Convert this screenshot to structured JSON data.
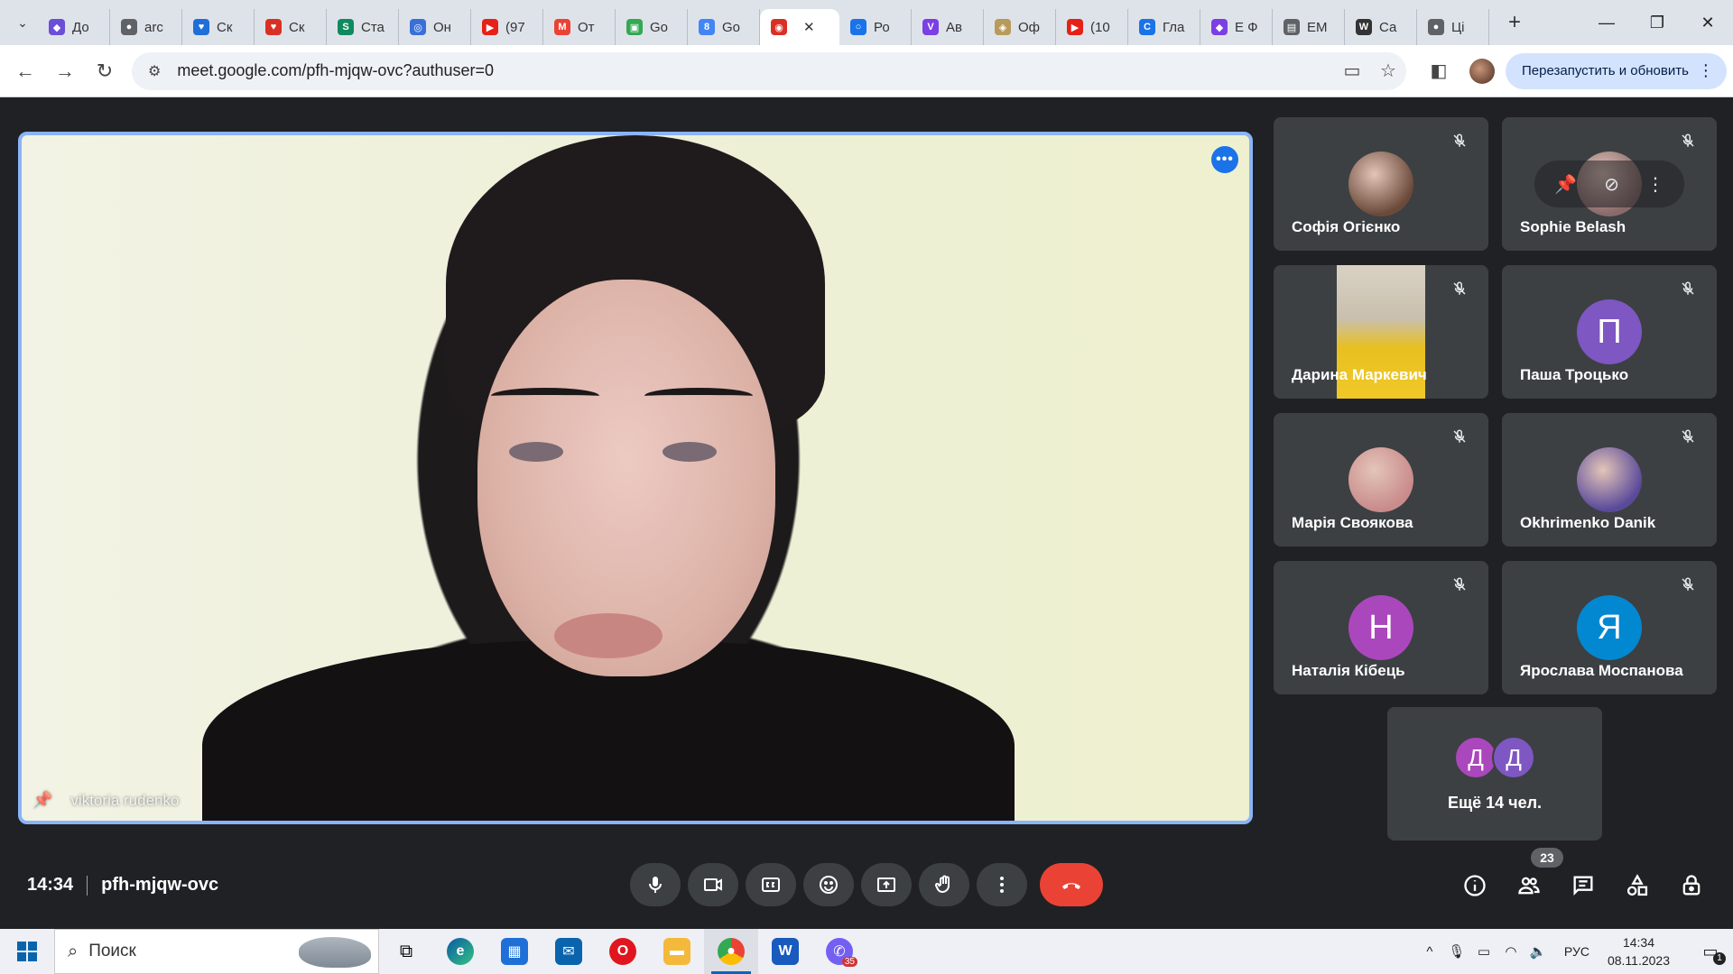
{
  "browser": {
    "tabs": [
      {
        "label": "До",
        "color": "#6b4fd8",
        "glyph": "◆"
      },
      {
        "label": "arc",
        "color": "#5f6368",
        "glyph": "●"
      },
      {
        "label": "Ск",
        "color": "#1e6fd9",
        "glyph": "♥"
      },
      {
        "label": "Ск",
        "color": "#d93025",
        "glyph": "♥"
      },
      {
        "label": "Ста",
        "color": "#0f8a5f",
        "glyph": "S"
      },
      {
        "label": "Он",
        "color": "#3a6fd8",
        "glyph": "◎"
      },
      {
        "label": "(97",
        "color": "#e62117",
        "glyph": "▶"
      },
      {
        "label": "От",
        "color": "#ea4335",
        "glyph": "M"
      },
      {
        "label": "Go",
        "color": "#34a853",
        "glyph": "▣"
      },
      {
        "label": "Go",
        "color": "#4285f4",
        "glyph": "8"
      },
      {
        "label": "",
        "color": "#d93025",
        "glyph": "◉",
        "active": true
      },
      {
        "label": "Ро",
        "color": "#1a73e8",
        "glyph": "○"
      },
      {
        "label": "Ав",
        "color": "#7b3fe4",
        "glyph": "V"
      },
      {
        "label": "Оф",
        "color": "#b89a5a",
        "glyph": "◈"
      },
      {
        "label": "(10",
        "color": "#e62117",
        "glyph": "▶"
      },
      {
        "label": "Гла",
        "color": "#1a73e8",
        "glyph": "C"
      },
      {
        "label": "Е Ф",
        "color": "#7b3fe4",
        "glyph": "◆"
      },
      {
        "label": "ЕМ",
        "color": "#5f6368",
        "glyph": "▤"
      },
      {
        "label": "Са",
        "color": "#333333",
        "glyph": "W"
      },
      {
        "label": "Ці",
        "color": "#5f6368",
        "glyph": "●"
      }
    ],
    "url": "meet.google.com/pfh-mjqw-ovc?authuser=0",
    "relaunch_label": "Перезапустить и обновить"
  },
  "meeting": {
    "main_speaker": "viktoria rudenko",
    "time": "14:34",
    "code": "pfh-mjqw-ovc",
    "participant_count": "23",
    "participants": [
      {
        "name": "Софія Огієнко",
        "type": "photo",
        "color": "#6b4a3a",
        "initial": ""
      },
      {
        "name": "Sophie Belash",
        "type": "photo",
        "color": "#8a6a6a",
        "initial": ""
      },
      {
        "name": "Дарина Маркевич",
        "type": "video",
        "color": "#e8c020",
        "initial": ""
      },
      {
        "name": "Паша Троцько",
        "type": "initial",
        "color": "#7e57c2",
        "initial": "П"
      },
      {
        "name": "Марія Своякова",
        "type": "photo",
        "color": "#c98b8b",
        "initial": ""
      },
      {
        "name": "Okhrimenko Danik",
        "type": "photo",
        "color": "#5a4a9a",
        "initial": ""
      },
      {
        "name": "Наталія Кібець",
        "type": "initial",
        "color": "#ab47bc",
        "initial": "Н"
      },
      {
        "name": "Ярослава Моспанова",
        "type": "initial",
        "color": "#0288d1",
        "initial": "Я"
      }
    ],
    "more": {
      "label": "Ещё 14 чел.",
      "initials": [
        "Д",
        "Д"
      ],
      "colors": [
        "#ab47bc",
        "#7e57c2"
      ]
    }
  },
  "taskbar": {
    "search_label": "Поиск",
    "lang": "РУС",
    "time": "14:34",
    "date": "08.11.2023",
    "viber_count": "35",
    "notifications": "1"
  }
}
